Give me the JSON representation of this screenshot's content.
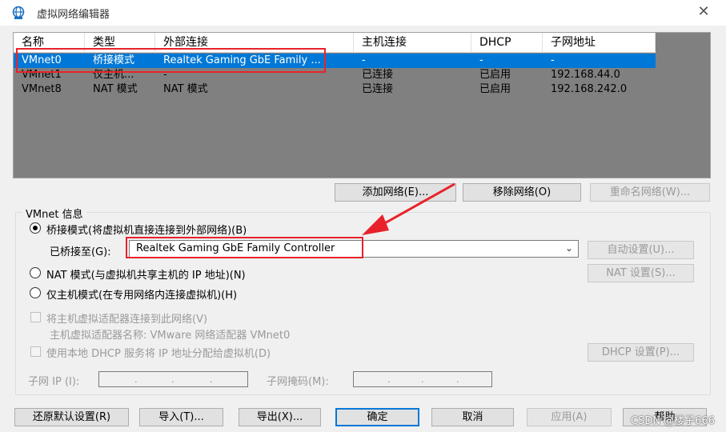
{
  "window": {
    "title": "虚拟网络编辑器",
    "close_glyph": "✕"
  },
  "table": {
    "headers": [
      "名称",
      "类型",
      "外部连接",
      "主机连接",
      "DHCP",
      "子网地址"
    ],
    "rows": [
      [
        "VMnet0",
        "桥接模式",
        "Realtek Gaming GbE Family ...",
        "-",
        "-",
        "-"
      ],
      [
        "VMnet1",
        "仅主机...",
        "-",
        "已连接",
        "已启用",
        "192.168.44.0"
      ],
      [
        "VMnet8",
        "NAT 模式",
        "NAT 模式",
        "已连接",
        "已启用",
        "192.168.242.0"
      ]
    ],
    "selected_index": 0
  },
  "table_buttons": {
    "add": "添加网络(E)...",
    "remove": "移除网络(O)",
    "rename": "重命名网络(W)..."
  },
  "vmnet_info": {
    "group_label": "VMnet 信息",
    "bridged_label": "桥接模式(将虚拟机直接连接到外部网络)(B)",
    "bridged_to_label": "已桥接至(G):",
    "bridged_to_value": "Realtek Gaming GbE Family Controller",
    "auto_settings": "自动设置(U)...",
    "nat_label": "NAT 模式(与虚拟机共享主机的 IP 地址)(N)",
    "nat_settings": "NAT 设置(S)...",
    "hostonly_label": "仅主机模式(在专用网络内连接虚拟机)(H)",
    "connect_adapter_label": "将主机虚拟适配器连接到此网络(V)",
    "adapter_name_label": "主机虚拟适配器名称: VMware 网络适配器 VMnet0",
    "dhcp_label": "使用本地 DHCP 服务将 IP 地址分配给虚拟机(D)",
    "dhcp_settings": "DHCP 设置(P)...",
    "subnet_ip_label": "子网 IP (I):",
    "subnet_mask_label": "子网掩码(M):",
    "selected_mode": "bridged"
  },
  "bottom_buttons": {
    "restore": "还原默认设置(R)",
    "import": "导入(T)...",
    "export": "导出(X)...",
    "ok": "确定",
    "cancel": "取消",
    "apply": "应用(A)",
    "help": "帮助"
  },
  "watermark": "CSDN @楼子666",
  "colors": {
    "selection": "#0078d7",
    "annotation": "#e8222a",
    "table_bg": "#808080"
  }
}
